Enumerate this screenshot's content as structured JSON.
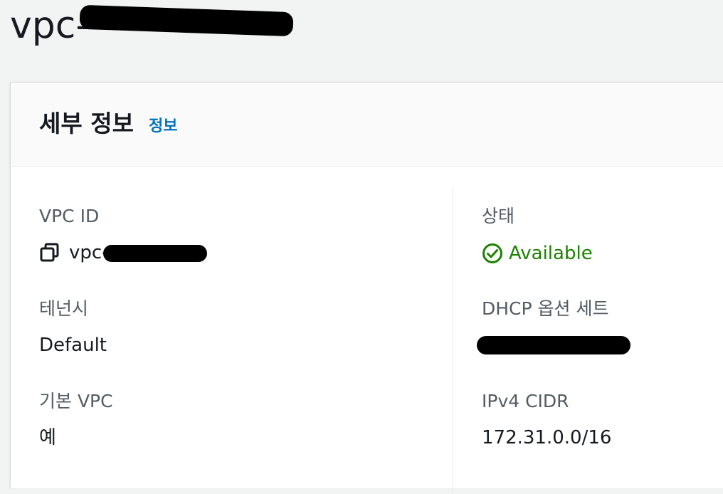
{
  "page": {
    "title": "vpc-"
  },
  "details": {
    "heading": "세부 정보",
    "info_link": "정보"
  },
  "fields": {
    "vpc_id": {
      "label": "VPC ID",
      "value": "vpc-7"
    },
    "state": {
      "label": "상태",
      "value": "Available"
    },
    "tenancy": {
      "label": "테넌시",
      "value": "Default"
    },
    "dhcp_options": {
      "label": "DHCP 옵션 세트",
      "value": ""
    },
    "default_vpc": {
      "label": "기본 VPC",
      "value": "예"
    },
    "ipv4_cidr": {
      "label": "IPv4 CIDR",
      "value": "172.31.0.0/16"
    }
  },
  "colors": {
    "status_available": "#1d8102",
    "link": "#0073bb"
  },
  "icons": {
    "copy": "copy-icon",
    "status": "status-positive-icon"
  }
}
